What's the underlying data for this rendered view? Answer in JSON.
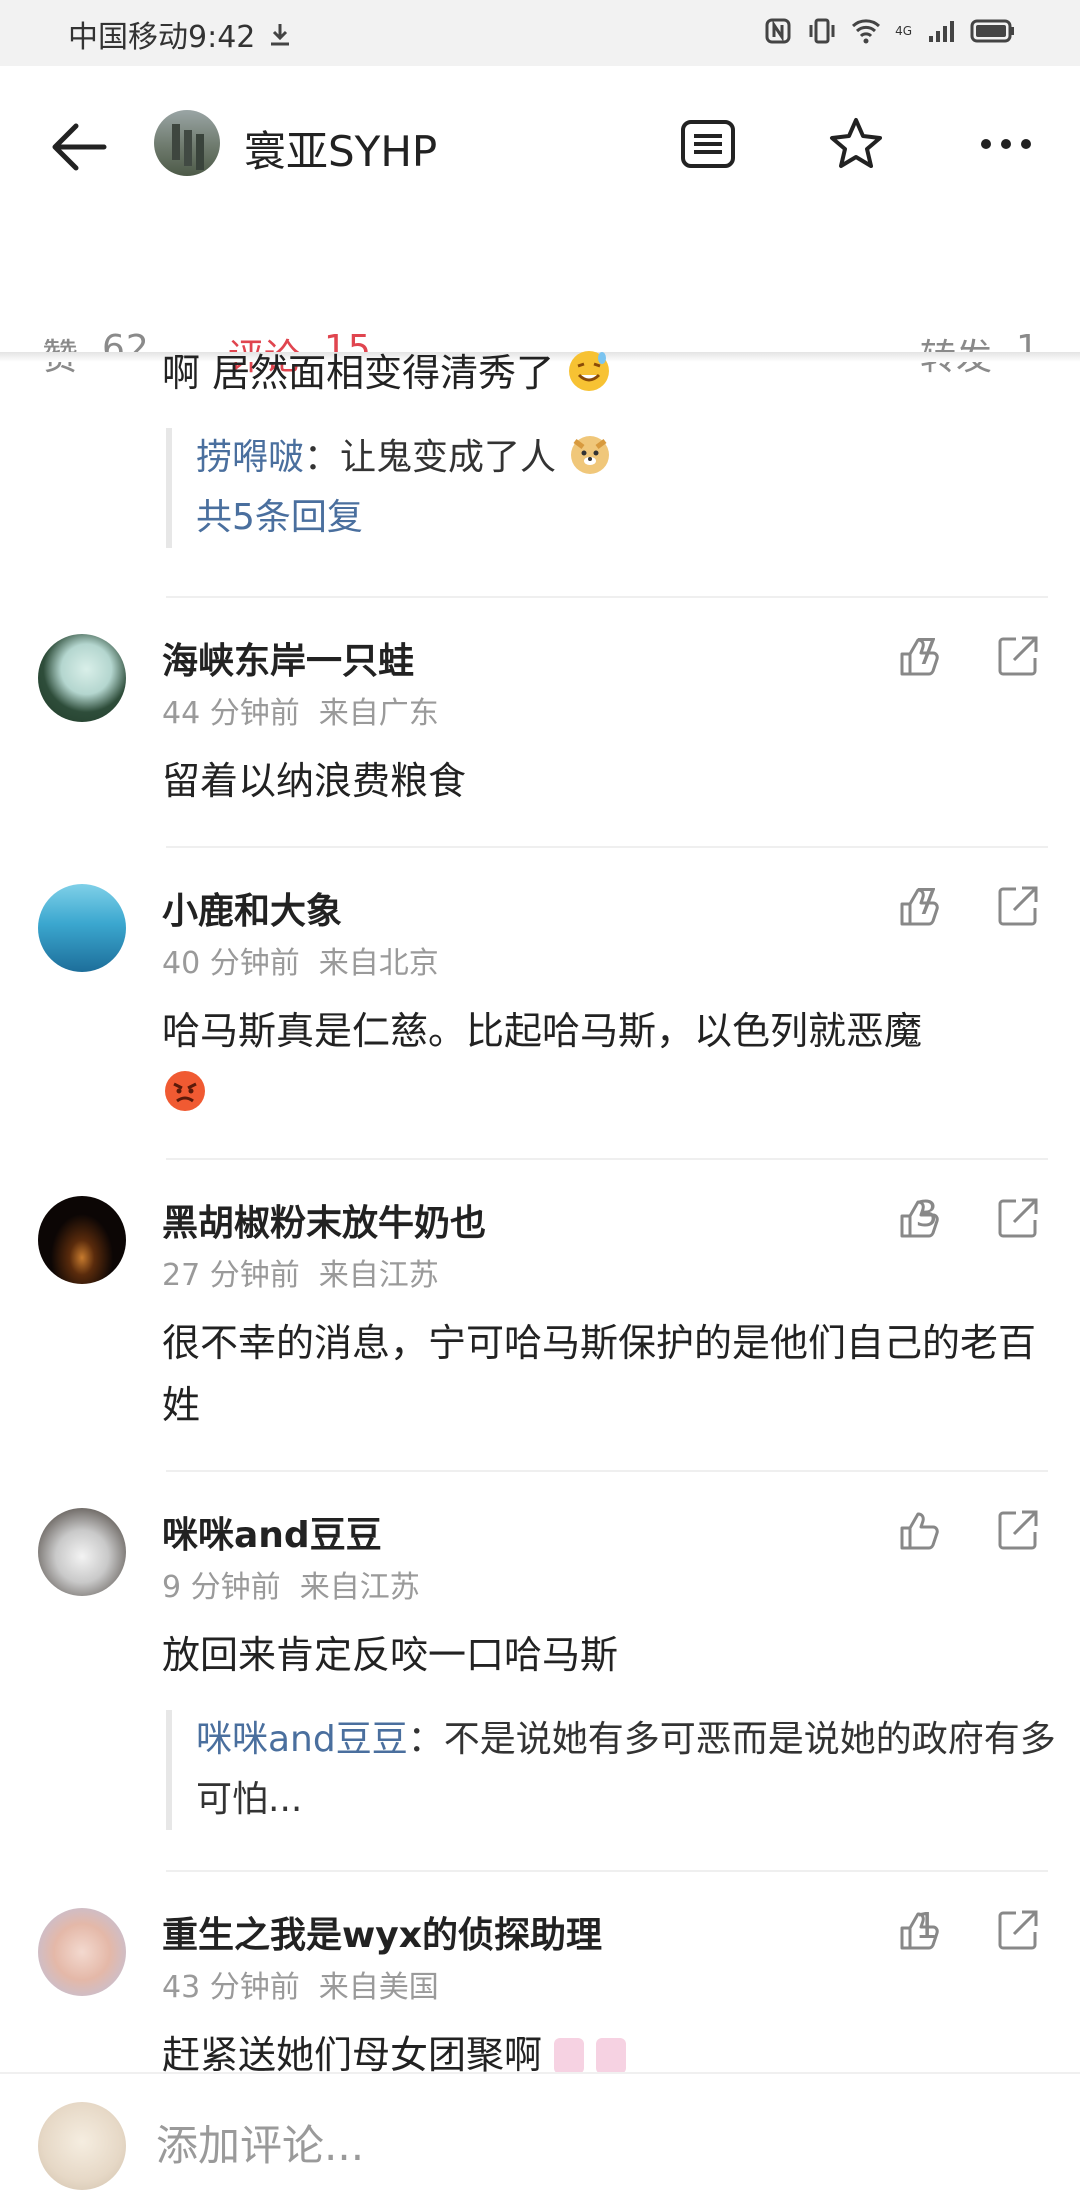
{
  "status_bar": {
    "carrier_time": "中国移动9:42",
    "network": "4G"
  },
  "header": {
    "title": "寰亚SYHP"
  },
  "tabs": {
    "likes_label": "赞",
    "likes_count": "62",
    "comments_label": "评论",
    "comments_count": "15",
    "reposts_label": "转发",
    "reposts_count": "1"
  },
  "top_comment": {
    "text": "啊 居然面相变得清秀了",
    "reply_user": "捞嘚啵",
    "reply_text": "：让鬼变成了人",
    "reply_count_label": "共5条回复"
  },
  "comments": [
    {
      "name": "海峡东岸一只蛙",
      "time": "44 分钟前",
      "from": "来自广东",
      "likes": "7",
      "text": "留着以纳浪费粮食"
    },
    {
      "name": "小鹿和大象",
      "time": "40 分钟前",
      "from": "来自北京",
      "likes": "7",
      "text": "哈马斯真是仁慈。比起哈马斯，以色列就恶魔"
    },
    {
      "name": "黑胡椒粉末放牛奶也",
      "time": "27 分钟前",
      "from": "来自江苏",
      "likes": "3",
      "text": "很不幸的消息，宁可哈马斯保护的是他们自己的老百姓"
    },
    {
      "name": "咪咪and豆豆",
      "time": "9 分钟前",
      "from": "来自江苏",
      "likes": "",
      "text": "放回来肯定反咬一口哈马斯",
      "reply_user": "咪咪and豆豆",
      "reply_text": "：不是说她有多可恶而是说她的政府有多可怕..."
    },
    {
      "name": "重生之我是wyx的侦探助理",
      "time": "43 分钟前",
      "from": "来自美国",
      "likes": "1",
      "text": "赶紧送她们母女团聚啊"
    }
  ],
  "bottom": {
    "input_placeholder": "添加评论..."
  },
  "colors": {
    "accent": "#e0454f",
    "link": "#4a6f9e"
  }
}
